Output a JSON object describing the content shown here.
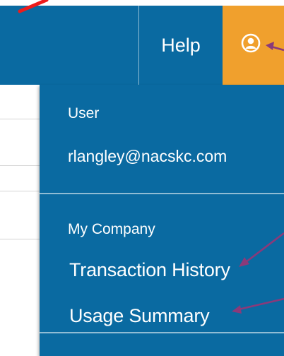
{
  "colors": {
    "nav_bg": "#0a6aa1",
    "menu_bg": "#0a6aa1",
    "accent": "#f0a02d",
    "annotation_arrow": "#8a3a7a",
    "annotation_red": "#ee1b1b"
  },
  "topbar": {
    "help_label": "Help",
    "user_icon": "user-circle-icon"
  },
  "dropdown": {
    "user_section_label": "User",
    "user_email": "rlangley@nacskc.com",
    "company_section_label": "My Company",
    "items": [
      {
        "label": "Transaction History"
      },
      {
        "label": "Usage Summary"
      }
    ]
  }
}
